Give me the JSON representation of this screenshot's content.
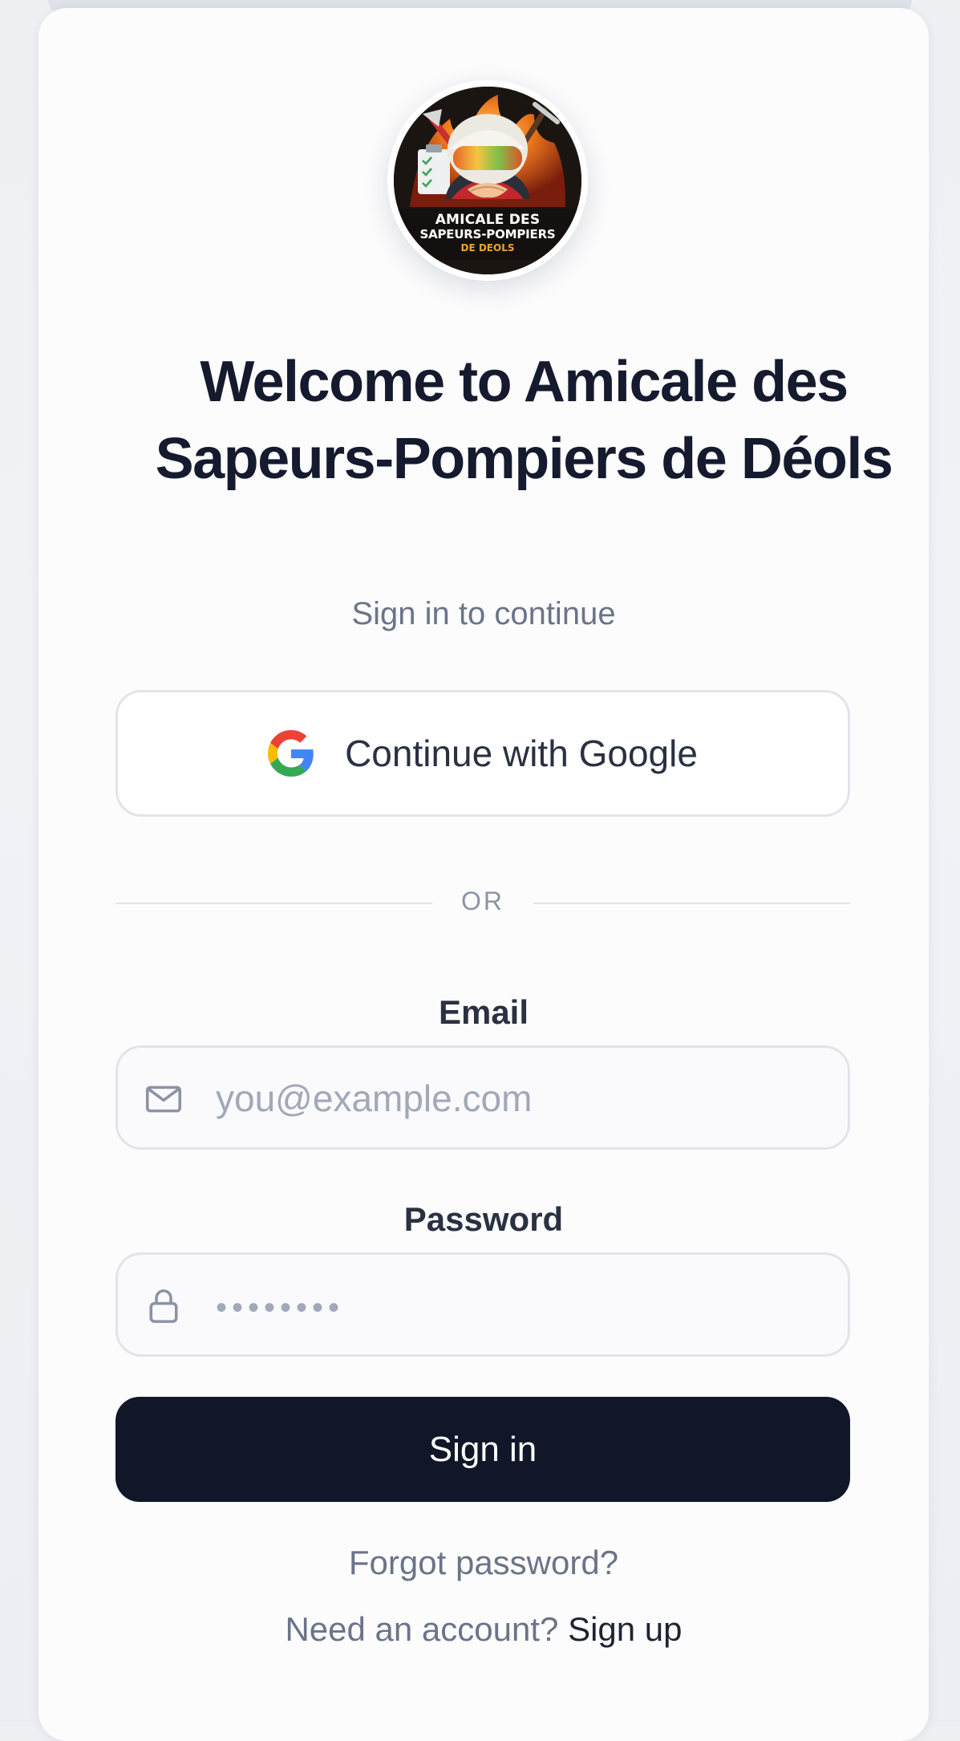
{
  "logo": {
    "line1": "AMICALE DES",
    "line2": "SAPEURS-POMPIERS",
    "line3": "DE DEOLS"
  },
  "heading": {
    "title": "Welcome to Amicale des Sapeurs-Pompiers de Déols",
    "subtitle": "Sign in to continue"
  },
  "google": {
    "label": "Continue with Google",
    "icon": "google-icon"
  },
  "divider": {
    "text": "OR"
  },
  "email": {
    "label": "Email",
    "placeholder": "you@example.com",
    "icon": "mail-icon"
  },
  "password": {
    "label": "Password",
    "placeholder": "••••••••",
    "icon": "lock-icon"
  },
  "actions": {
    "sign_in": "Sign in",
    "forgot": "Forgot password?",
    "need_account": "Need an account?",
    "sign_up": "Sign up"
  },
  "colors": {
    "primary_button": "#111628",
    "muted_text": "#6b7488",
    "heading": "#151a2e"
  }
}
